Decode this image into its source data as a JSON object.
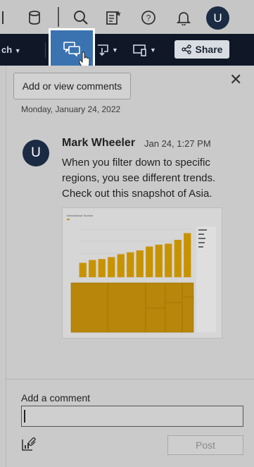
{
  "toolbar": {
    "avatar_initial": "U",
    "icons": [
      "database-icon",
      "search-icon",
      "favorites-list-icon",
      "help-icon",
      "notifications-icon"
    ]
  },
  "darkbar": {
    "left_text": "ch",
    "share_label": "Share",
    "buttons": [
      "comments-icon",
      "download-icon",
      "device-preview-icon"
    ]
  },
  "tooltip": {
    "text": "Add or view comments"
  },
  "panel": {
    "date": "Monday, January 24, 2022",
    "comment": {
      "avatar_initial": "U",
      "author": "Mark Wheeler",
      "time": "Jan 24, 1:27 PM",
      "text": "When you filter down to specific regions, you see different trends. Check out this snapshot of Asia."
    },
    "add_comment_label": "Add a comment",
    "input_value": "",
    "post_label": "Post"
  },
  "thumbnail": {
    "title": "International Tourism",
    "bar_values": [
      1.5,
      1.8,
      1.9,
      2.1,
      2.4,
      2.6,
      2.8,
      3.2,
      3.4,
      3.5,
      3.9,
      4.6
    ],
    "ylim": [
      0,
      5
    ],
    "colors": {
      "bars": "#c89300",
      "treemap": "#b8860b"
    }
  }
}
